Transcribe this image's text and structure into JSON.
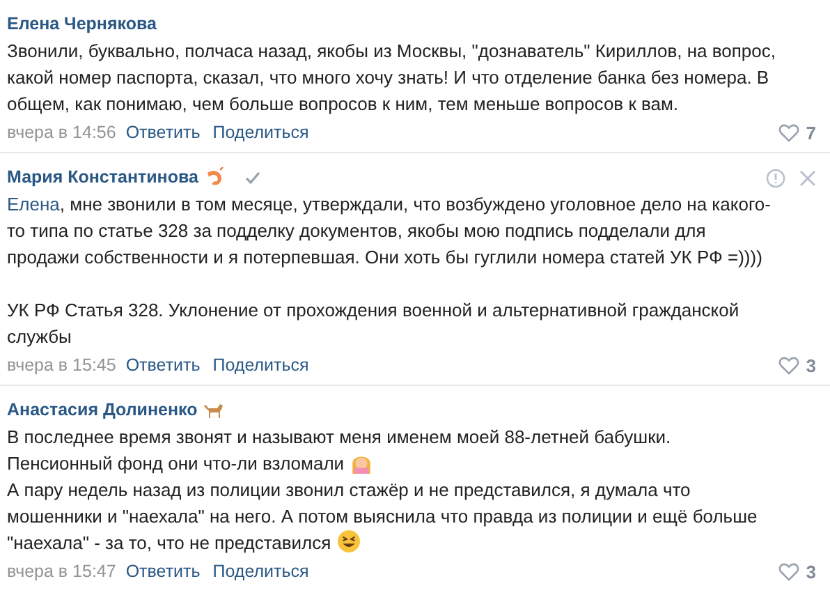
{
  "comments": [
    {
      "author": "Елена Чернякова",
      "verified": false,
      "hovered": false,
      "paragraphs": [
        {
          "gap_before": false,
          "parts": [
            {
              "kind": "text",
              "text": "Звонили, буквально, полчаса назад, якобы из Москвы, \"дознаватель\" Кириллов, на вопрос, какой номер паспорта, сказал, что много хочу знать! И что отделение банка без номера. В общем, как понимаю, чем больше вопросов к ним, тем меньше вопросов к вам."
            }
          ]
        }
      ],
      "time": "вчера в 14:56",
      "reply": "Ответить",
      "share": "Поделиться",
      "likes": "7"
    },
    {
      "author": "Мария Константинова",
      "author_icon": {
        "kind": "shrimp"
      },
      "verified": true,
      "hovered": true,
      "paragraphs": [
        {
          "gap_before": false,
          "parts": [
            {
              "kind": "mention",
              "text": "Елена"
            },
            {
              "kind": "text",
              "text": ", мне звонили в том месяце, утверждали, что возбуждено уголовное дело на какого-то типа по статье 328 за подделку документов, якобы мою подпись подделали для продажи собственности и я потерпевшая. Они хоть бы гуглили номера статей УК РФ =))))"
            }
          ]
        },
        {
          "gap_before": true,
          "parts": [
            {
              "kind": "text",
              "text": "УК РФ Статья 328. Уклонение от прохождения военной и альтернативной гражданской службы"
            }
          ]
        }
      ],
      "time": "вчера в 15:45",
      "reply": "Ответить",
      "share": "Поделиться",
      "likes": "3"
    },
    {
      "author": "Анастасия Долиненко",
      "author_icon": {
        "kind": "dog"
      },
      "verified": false,
      "hovered": false,
      "paragraphs": [
        {
          "gap_before": false,
          "parts": [
            {
              "kind": "text",
              "text": "В последнее время звонят и называют меня именем моей 88-летней бабушки."
            }
          ]
        },
        {
          "gap_before": false,
          "parts": [
            {
              "kind": "text",
              "text": "Пенсионный фонд они что-ли взломали"
            },
            {
              "kind": "facepalm"
            }
          ]
        },
        {
          "gap_before": false,
          "parts": [
            {
              "kind": "text",
              "text": "А пару недель назад из полиции звонил стажёр и не представился, я думала что мошенники и \"наехала\" на него. А потом выяснила что правда из полиции и ещё больше \"наехала\" - за то, что не представился"
            },
            {
              "kind": "laugh"
            }
          ]
        }
      ],
      "time": "вчера в 15:47",
      "reply": "Ответить",
      "share": "Поделиться",
      "likes": "3"
    }
  ]
}
